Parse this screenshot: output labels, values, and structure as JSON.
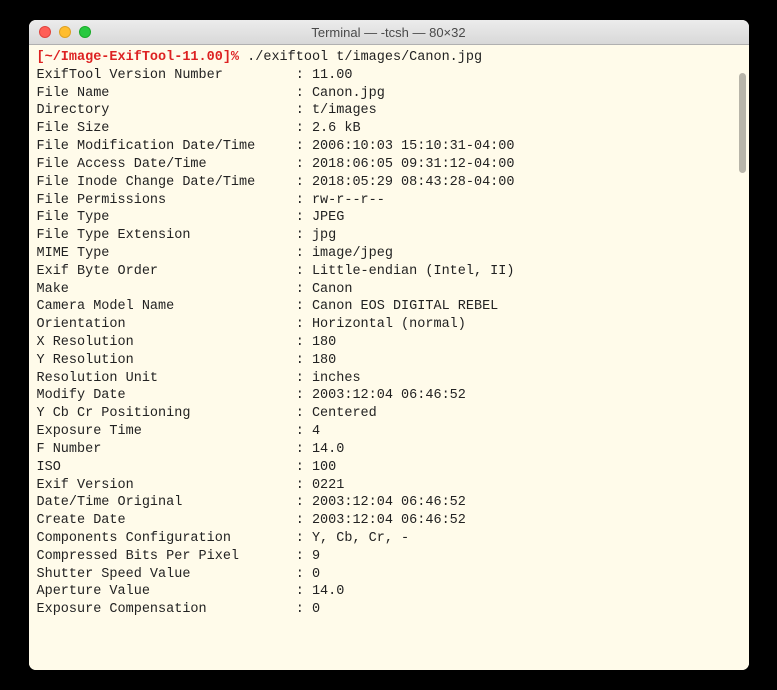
{
  "window": {
    "title": "Terminal — -tcsh — 80×32"
  },
  "prompt": {
    "path": "[~/Image-ExifTool-11.00]%",
    "command": " ./exiftool t/images/Canon.jpg"
  },
  "rows": [
    {
      "k": "ExifTool Version Number",
      "v": "11.00"
    },
    {
      "k": "File Name",
      "v": "Canon.jpg"
    },
    {
      "k": "Directory",
      "v": "t/images"
    },
    {
      "k": "File Size",
      "v": "2.6 kB"
    },
    {
      "k": "File Modification Date/Time",
      "v": "2006:10:03 15:10:31-04:00"
    },
    {
      "k": "File Access Date/Time",
      "v": "2018:06:05 09:31:12-04:00"
    },
    {
      "k": "File Inode Change Date/Time",
      "v": "2018:05:29 08:43:28-04:00"
    },
    {
      "k": "File Permissions",
      "v": "rw-r--r--"
    },
    {
      "k": "File Type",
      "v": "JPEG"
    },
    {
      "k": "File Type Extension",
      "v": "jpg"
    },
    {
      "k": "MIME Type",
      "v": "image/jpeg"
    },
    {
      "k": "Exif Byte Order",
      "v": "Little-endian (Intel, II)"
    },
    {
      "k": "Make",
      "v": "Canon"
    },
    {
      "k": "Camera Model Name",
      "v": "Canon EOS DIGITAL REBEL"
    },
    {
      "k": "Orientation",
      "v": "Horizontal (normal)"
    },
    {
      "k": "X Resolution",
      "v": "180"
    },
    {
      "k": "Y Resolution",
      "v": "180"
    },
    {
      "k": "Resolution Unit",
      "v": "inches"
    },
    {
      "k": "Modify Date",
      "v": "2003:12:04 06:46:52"
    },
    {
      "k": "Y Cb Cr Positioning",
      "v": "Centered"
    },
    {
      "k": "Exposure Time",
      "v": "4"
    },
    {
      "k": "F Number",
      "v": "14.0"
    },
    {
      "k": "ISO",
      "v": "100"
    },
    {
      "k": "Exif Version",
      "v": "0221"
    },
    {
      "k": "Date/Time Original",
      "v": "2003:12:04 06:46:52"
    },
    {
      "k": "Create Date",
      "v": "2003:12:04 06:46:52"
    },
    {
      "k": "Components Configuration",
      "v": "Y, Cb, Cr, -"
    },
    {
      "k": "Compressed Bits Per Pixel",
      "v": "9"
    },
    {
      "k": "Shutter Speed Value",
      "v": "0"
    },
    {
      "k": "Aperture Value",
      "v": "14.0"
    },
    {
      "k": "Exposure Compensation",
      "v": "0"
    }
  ]
}
